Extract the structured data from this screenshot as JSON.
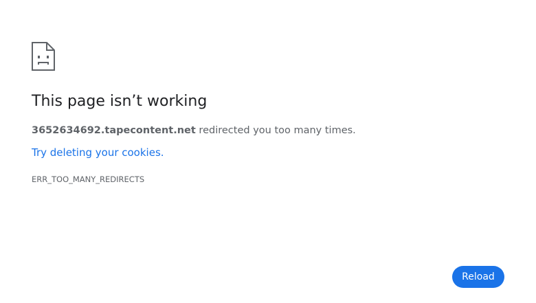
{
  "icon": "sad-document-icon",
  "heading": "This page isn’t working",
  "summary": {
    "host": "3652634692.tapecontent.net",
    "message": " redirected you too many times."
  },
  "suggestion": {
    "link_text": "Try deleting your cookies",
    "suffix": "."
  },
  "error_code": "ERR_TOO_MANY_REDIRECTS",
  "reload_button": {
    "label": "Reload"
  },
  "colors": {
    "accent": "#1a73e8",
    "heading_text": "#202124",
    "body_text": "#5f6368",
    "background": "#ffffff"
  }
}
